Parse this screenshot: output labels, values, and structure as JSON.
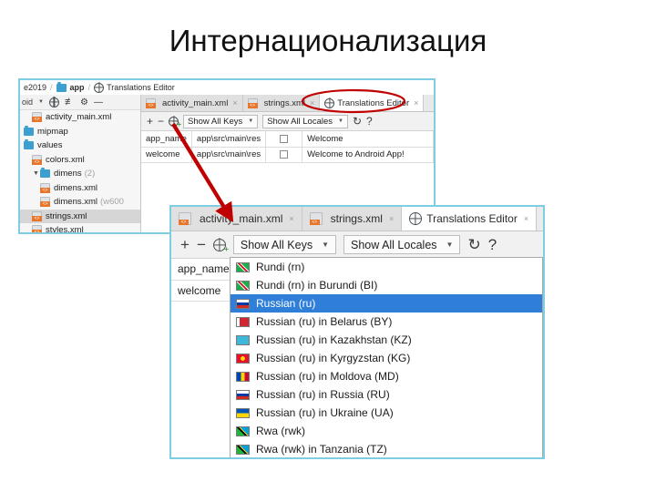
{
  "slide": {
    "title": "Интернационализация"
  },
  "ide": {
    "breadcrumb": {
      "project": "e2019",
      "module": "app",
      "editor": "Translations Editor",
      "separator": "/"
    },
    "project_pane": {
      "toolbar_label": "oid",
      "tree": [
        {
          "label": "activity_main.xml",
          "icon": "xml-file-icon",
          "depth": 1,
          "type": "file",
          "selected": false,
          "suffix": ""
        },
        {
          "label": "mipmap",
          "icon": "folder-icon",
          "depth": 0,
          "type": "folder",
          "selected": false,
          "suffix": ""
        },
        {
          "label": "values",
          "icon": "folder-icon",
          "depth": 0,
          "type": "folder",
          "selected": false,
          "suffix": ""
        },
        {
          "label": "colors.xml",
          "icon": "xml-file-icon",
          "depth": 1,
          "type": "file",
          "selected": false,
          "suffix": ""
        },
        {
          "label": "dimens",
          "icon": "folder-icon",
          "depth": 1,
          "type": "folder-expanded",
          "selected": false,
          "suffix": "(2)"
        },
        {
          "label": "dimens.xml",
          "icon": "xml-file-icon",
          "depth": 2,
          "type": "file",
          "selected": false,
          "suffix": ""
        },
        {
          "label": "dimens.xml",
          "icon": "xml-file-icon",
          "depth": 2,
          "type": "file",
          "selected": false,
          "suffix": "(w600"
        },
        {
          "label": "strings.xml",
          "icon": "xml-file-icon",
          "depth": 1,
          "type": "file",
          "selected": true,
          "suffix": ""
        },
        {
          "label": "styles.xml",
          "icon": "xml-file-icon",
          "depth": 1,
          "type": "file",
          "selected": false,
          "suffix": ""
        }
      ]
    },
    "tabs": [
      {
        "label": "activity_main.xml",
        "icon": "xml-file-icon",
        "active": false,
        "close": "×"
      },
      {
        "label": "strings.xml",
        "icon": "xml-file-icon",
        "active": false,
        "close": "×"
      },
      {
        "label": "Translations Editor",
        "icon": "globe-icon",
        "active": true,
        "close": "×"
      }
    ],
    "toolbar": {
      "add_label": "+",
      "remove_label": "−",
      "add_locale_label": "globe-plus-icon",
      "keys_filter": "Show All Keys",
      "locales_filter": "Show All Locales",
      "refresh_label": "↻",
      "help_label": "?",
      "caret": "▼"
    },
    "table": {
      "rows": [
        {
          "key": "app_name",
          "resource_folder": "app\\src\\main\\res",
          "untranslatable": false,
          "default_value": "Welcome"
        },
        {
          "key": "welcome",
          "resource_folder": "app\\src\\main\\res",
          "untranslatable": false,
          "default_value": "Welcome to Android App!"
        }
      ]
    },
    "locale_dropdown": {
      "items": [
        {
          "label": "Rundi (rn)",
          "flag": "burundi-flag-icon",
          "selected": false
        },
        {
          "label": "Rundi (rn) in Burundi (BI)",
          "flag": "burundi-flag-icon",
          "selected": false
        },
        {
          "label": "Russian (ru)",
          "flag": "russia-flag-icon",
          "selected": true
        },
        {
          "label": "Russian (ru) in Belarus (BY)",
          "flag": "belarus-flag-icon",
          "selected": false
        },
        {
          "label": "Russian (ru) in Kazakhstan (KZ)",
          "flag": "kazakhstan-flag-icon",
          "selected": false
        },
        {
          "label": "Russian (ru) in Kyrgyzstan (KG)",
          "flag": "kyrgyzstan-flag-icon",
          "selected": false
        },
        {
          "label": "Russian (ru) in Moldova (MD)",
          "flag": "moldova-flag-icon",
          "selected": false
        },
        {
          "label": "Russian (ru) in Russia (RU)",
          "flag": "russia-flag-icon",
          "selected": false
        },
        {
          "label": "Russian (ru) in Ukraine (UA)",
          "flag": "ukraine-flag-icon",
          "selected": false
        },
        {
          "label": "Rwa (rwk)",
          "flag": "tanzania-flag-icon",
          "selected": false
        },
        {
          "label": "Rwa (rwk) in Tanzania (TZ)",
          "flag": "tanzania-flag-icon",
          "selected": false
        }
      ]
    }
  },
  "annotations": {
    "highlight_color": "#c00000",
    "ellipse_target": "Translations Editor",
    "arrow_from": "add-locale-globe-button",
    "arrow_to": "zoomed-translations-editor-window"
  },
  "colors": {
    "window_border": "#7ecde2",
    "selection_blue": "#2f7fd8",
    "annotation_red": "#c00000",
    "tree_selection": "#d6d6d6"
  }
}
